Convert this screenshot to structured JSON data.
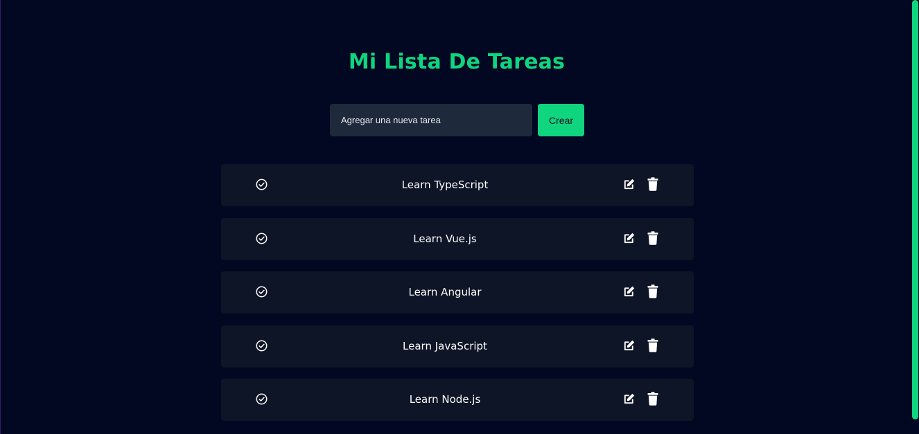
{
  "app": {
    "title": "Mi Lista De Tareas",
    "accent_color": "#10d57f",
    "background_color": "#020722"
  },
  "new_task": {
    "placeholder": "Agregar una nueva tarea",
    "value": "",
    "create_label": "Crear"
  },
  "tasks": [
    {
      "text": "Learn TypeScript",
      "check_icon": "check-circle-icon",
      "edit_icon": "edit-icon",
      "delete_icon": "trash-icon"
    },
    {
      "text": "Learn Vue.js",
      "check_icon": "check-circle-icon",
      "edit_icon": "edit-icon",
      "delete_icon": "trash-icon"
    },
    {
      "text": "Learn Angular",
      "check_icon": "check-circle-icon",
      "edit_icon": "edit-icon",
      "delete_icon": "trash-icon"
    },
    {
      "text": "Learn JavaScript",
      "check_icon": "check-circle-icon",
      "edit_icon": "edit-icon",
      "delete_icon": "trash-icon"
    },
    {
      "text": "Learn Node.js",
      "check_icon": "check-circle-icon",
      "edit_icon": "edit-icon",
      "delete_icon": "trash-icon"
    }
  ]
}
